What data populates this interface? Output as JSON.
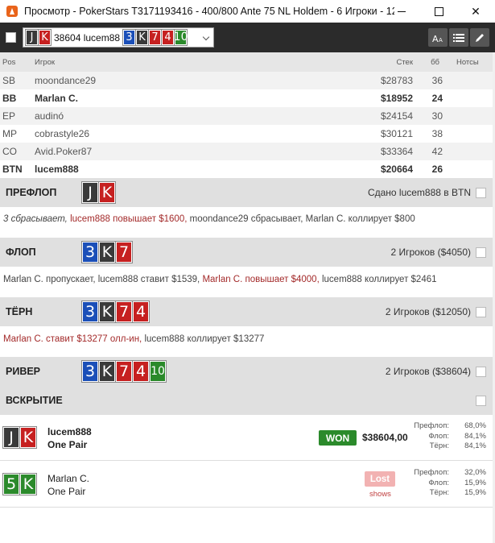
{
  "window": {
    "title": "Просмотр - PokerStars T3171193416 - 400/800 Ante 75 NL Holdem - 6 Игроки - 12..."
  },
  "toolbar": {
    "hand_id": "38604 lucem88",
    "hand_cards": [
      {
        "rank": "J",
        "suit": "s"
      },
      {
        "rank": "K",
        "suit": "h"
      }
    ],
    "board_cards": [
      {
        "rank": "3",
        "suit": "d"
      },
      {
        "rank": "K",
        "suit": "s"
      },
      {
        "rank": "7",
        "suit": "h"
      },
      {
        "rank": "4",
        "suit": "h"
      },
      {
        "rank": "10",
        "suit": "c"
      }
    ],
    "tools": [
      "font-size-icon",
      "list-icon",
      "edit-icon"
    ]
  },
  "players_table": {
    "headers": {
      "pos": "Pos",
      "name": "Игрок",
      "stack": "Стек",
      "bb": "бб",
      "notes": "Нотсы"
    },
    "rows": [
      {
        "pos": "SB",
        "name": "moondance29",
        "stack": "$28783",
        "bb": "36",
        "bold": false
      },
      {
        "pos": "BB",
        "name": "Marlan C.",
        "stack": "$18952",
        "bb": "24",
        "bold": true
      },
      {
        "pos": "EP",
        "name": "audinó",
        "stack": "$24154",
        "bb": "30",
        "bold": false
      },
      {
        "pos": "MP",
        "name": "cobrastyle26",
        "stack": "$30121",
        "bb": "38",
        "bold": false
      },
      {
        "pos": "CO",
        "name": "Avid.Poker87",
        "stack": "$33364",
        "bb": "42",
        "bold": false
      },
      {
        "pos": "BTN",
        "name": "lucem888",
        "stack": "$20664",
        "bb": "26",
        "bold": true
      }
    ]
  },
  "preflop": {
    "label": "ПРЕФЛОП",
    "info": "Сдано lucem888 в BTN",
    "cards": [
      {
        "rank": "J",
        "suit": "s"
      },
      {
        "rank": "K",
        "suit": "h"
      }
    ],
    "actions": {
      "a1": "3 сбрасывает,",
      "a2": "lucem888 повышает $1600,",
      "a3": "moondance29 сбрасывает, Marlan C. коллирует $800"
    }
  },
  "flop": {
    "label": "ФЛОП",
    "info": "2 Игроков ($4050)",
    "cards": [
      {
        "rank": "3",
        "suit": "d"
      },
      {
        "rank": "K",
        "suit": "s"
      },
      {
        "rank": "7",
        "suit": "h"
      }
    ],
    "actions": {
      "a1": "Marlan C. пропускает, lucem888 ставит $1539,",
      "a2": "Marlan C. повышает $4000,",
      "a3": "lucem888 коллирует $2461"
    }
  },
  "turn": {
    "label": "ТЁРН",
    "info": "2 Игроков ($12050)",
    "cards": [
      {
        "rank": "3",
        "suit": "d"
      },
      {
        "rank": "K",
        "suit": "s"
      },
      {
        "rank": "7",
        "suit": "h"
      },
      {
        "rank": "4",
        "suit": "h"
      }
    ],
    "actions": {
      "a1": "Marlan C. ставит $13277 олл-ин,",
      "a2": "lucem888 коллирует $13277"
    }
  },
  "river": {
    "label": "РИВЕР",
    "info": "2 Игроков ($38604)",
    "cards": [
      {
        "rank": "3",
        "suit": "d"
      },
      {
        "rank": "K",
        "suit": "s"
      },
      {
        "rank": "7",
        "suit": "h"
      },
      {
        "rank": "4",
        "suit": "h"
      },
      {
        "rank": "10",
        "suit": "c"
      }
    ]
  },
  "showdown": {
    "label": "ВСКРЫТИЕ",
    "players": [
      {
        "name": "lucem888",
        "hand": "One Pair",
        "cards": [
          {
            "rank": "J",
            "suit": "s"
          },
          {
            "rank": "K",
            "suit": "h"
          }
        ],
        "result": "WON",
        "amount": "$38604,00",
        "equity": [
          {
            "label": "Префлоп:",
            "value": "68,0%"
          },
          {
            "label": "Флоп:",
            "value": "84,1%"
          },
          {
            "label": "Тёрн:",
            "value": "84,1%"
          }
        ]
      },
      {
        "name": "Marlan C.",
        "hand": "One Pair",
        "cards": [
          {
            "rank": "5",
            "suit": "c"
          },
          {
            "rank": "K",
            "suit": "c"
          }
        ],
        "result": "Lost",
        "shows": "shows",
        "equity": [
          {
            "label": "Префлоп:",
            "value": "32,0%"
          },
          {
            "label": "Флоп:",
            "value": "15,9%"
          },
          {
            "label": "Тёрн:",
            "value": "15,9%"
          }
        ]
      }
    ]
  }
}
